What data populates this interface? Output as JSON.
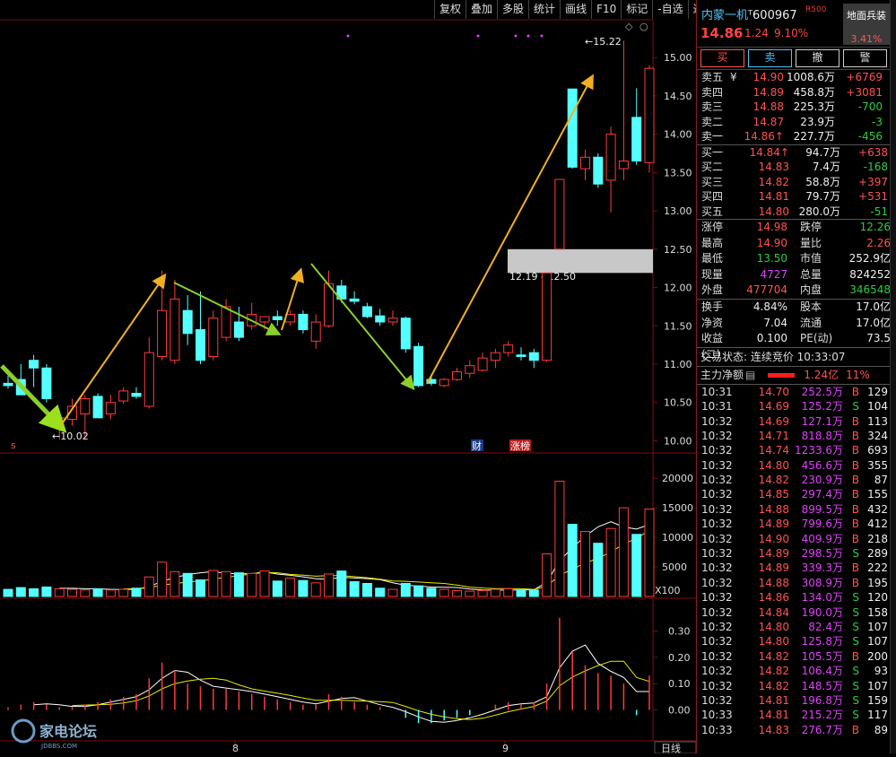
{
  "toolbar": {
    "items": [
      "复权",
      "叠加",
      "多股",
      "统计",
      "画线",
      "F10",
      "标记",
      "-自选",
      "返回"
    ]
  },
  "colors": {
    "up": "#ff3b3b",
    "down": "#54ffff",
    "ma_white": "#ffffff",
    "ma_yellow": "#e8e800",
    "arrow_orange": "#f0b020",
    "arrow_green": "#8ccf2a"
  },
  "chart": {
    "price_axis": {
      "ticks": [
        "15.00",
        "14.50",
        "14.00",
        "13.50",
        "13.00",
        "12.50",
        "12.00",
        "11.50",
        "11.00",
        "10.50",
        "10.00"
      ]
    },
    "high_label": "15.22",
    "low_label": "10.02",
    "gap_label": "12.19 - 12.50",
    "markers": {
      "s": "s",
      "cai": "财",
      "zhangbang": "涨榜"
    },
    "volume_axis": {
      "ticks": [
        "20000",
        "15000",
        "10000",
        "5000"
      ],
      "unit": "X100"
    },
    "macd_axis": {
      "ticks": [
        "0.30",
        "0.20",
        "0.10",
        "0.00"
      ]
    },
    "date_labels": {
      "m8": "8",
      "m9": "9"
    },
    "period_label": "日线",
    "watermark": {
      "text": "家电论坛",
      "sub": "JDBBS.COM"
    }
  },
  "chart_data": {
    "type": "candlestick",
    "ylim": [
      9.9,
      15.4
    ],
    "candles": [
      {
        "o": 10.75,
        "h": 10.85,
        "l": 10.68,
        "c": 10.72
      },
      {
        "o": 10.8,
        "h": 11.0,
        "l": 10.65,
        "c": 10.6
      },
      {
        "o": 11.05,
        "h": 11.12,
        "l": 10.7,
        "c": 10.95
      },
      {
        "o": 10.95,
        "h": 11.0,
        "l": 10.5,
        "c": 10.55
      },
      {
        "o": 10.25,
        "h": 10.4,
        "l": 10.02,
        "c": 10.3
      },
      {
        "o": 10.28,
        "h": 10.55,
        "l": 10.2,
        "c": 10.45
      },
      {
        "o": 10.35,
        "h": 10.6,
        "l": 10.05,
        "c": 10.55
      },
      {
        "o": 10.58,
        "h": 10.62,
        "l": 10.3,
        "c": 10.3
      },
      {
        "o": 10.35,
        "h": 10.6,
        "l": 10.28,
        "c": 10.5
      },
      {
        "o": 10.52,
        "h": 10.7,
        "l": 10.48,
        "c": 10.65
      },
      {
        "o": 10.62,
        "h": 10.7,
        "l": 10.55,
        "c": 10.58
      },
      {
        "o": 10.45,
        "h": 11.35,
        "l": 10.42,
        "c": 11.15
      },
      {
        "o": 11.1,
        "h": 12.22,
        "l": 11.05,
        "c": 11.7
      },
      {
        "o": 11.05,
        "h": 12.1,
        "l": 11.0,
        "c": 11.85
      },
      {
        "o": 11.7,
        "h": 11.9,
        "l": 11.25,
        "c": 11.4
      },
      {
        "o": 11.45,
        "h": 11.95,
        "l": 11.0,
        "c": 11.05
      },
      {
        "o": 11.1,
        "h": 11.7,
        "l": 11.05,
        "c": 11.6
      },
      {
        "o": 11.35,
        "h": 11.85,
        "l": 11.3,
        "c": 11.75
      },
      {
        "o": 11.55,
        "h": 11.75,
        "l": 11.3,
        "c": 11.35
      },
      {
        "o": 11.5,
        "h": 11.8,
        "l": 11.45,
        "c": 11.65
      },
      {
        "o": 11.55,
        "h": 11.6,
        "l": 11.45,
        "c": 11.62
      },
      {
        "o": 11.62,
        "h": 11.7,
        "l": 11.5,
        "c": 11.58
      },
      {
        "o": 11.55,
        "h": 11.7,
        "l": 11.5,
        "c": 11.65
      },
      {
        "o": 11.65,
        "h": 11.7,
        "l": 11.4,
        "c": 11.45
      },
      {
        "o": 11.3,
        "h": 11.65,
        "l": 11.2,
        "c": 11.55
      },
      {
        "o": 11.5,
        "h": 12.22,
        "l": 11.48,
        "c": 12.05
      },
      {
        "o": 12.02,
        "h": 12.1,
        "l": 11.8,
        "c": 11.85
      },
      {
        "o": 11.85,
        "h": 11.95,
        "l": 11.78,
        "c": 11.82
      },
      {
        "o": 11.75,
        "h": 11.8,
        "l": 11.6,
        "c": 11.62
      },
      {
        "o": 11.63,
        "h": 11.72,
        "l": 11.5,
        "c": 11.55
      },
      {
        "o": 11.55,
        "h": 11.7,
        "l": 11.5,
        "c": 11.6
      },
      {
        "o": 11.6,
        "h": 11.62,
        "l": 11.15,
        "c": 11.2
      },
      {
        "o": 11.23,
        "h": 11.28,
        "l": 10.7,
        "c": 10.72
      },
      {
        "o": 10.8,
        "h": 10.85,
        "l": 10.72,
        "c": 10.75
      },
      {
        "o": 10.72,
        "h": 10.82,
        "l": 10.7,
        "c": 10.8
      },
      {
        "o": 10.8,
        "h": 10.95,
        "l": 10.78,
        "c": 10.9
      },
      {
        "o": 10.88,
        "h": 11.05,
        "l": 10.82,
        "c": 10.98
      },
      {
        "o": 10.92,
        "h": 11.15,
        "l": 10.9,
        "c": 11.08
      },
      {
        "o": 11.05,
        "h": 11.2,
        "l": 10.95,
        "c": 11.15
      },
      {
        "o": 11.15,
        "h": 11.3,
        "l": 11.1,
        "c": 11.25
      },
      {
        "o": 11.12,
        "h": 11.22,
        "l": 11.05,
        "c": 11.1
      },
      {
        "o": 11.15,
        "h": 11.2,
        "l": 10.95,
        "c": 11.05
      },
      {
        "o": 11.05,
        "h": 12.19,
        "l": 11.03,
        "c": 12.19
      },
      {
        "o": 12.5,
        "h": 13.41,
        "l": 12.5,
        "c": 13.41
      },
      {
        "o": 14.59,
        "h": 14.59,
        "l": 13.55,
        "c": 13.57
      },
      {
        "o": 13.55,
        "h": 13.8,
        "l": 13.4,
        "c": 13.7
      },
      {
        "o": 13.7,
        "h": 13.75,
        "l": 13.3,
        "c": 13.35
      },
      {
        "o": 13.4,
        "h": 14.1,
        "l": 12.98,
        "c": 14.0
      },
      {
        "o": 13.55,
        "h": 15.22,
        "l": 13.4,
        "c": 13.65
      },
      {
        "o": 14.22,
        "h": 14.6,
        "l": 13.6,
        "c": 13.65
      },
      {
        "o": 13.63,
        "h": 14.9,
        "l": 13.5,
        "c": 14.86
      }
    ],
    "volume_ylim": [
      0,
      22000
    ],
    "volumes": [
      1200,
      1500,
      1300,
      1600,
      1300,
      1200,
      1100,
      1300,
      1100,
      1200,
      1400,
      3300,
      5800,
      4200,
      3900,
      2800,
      4400,
      4200,
      4000,
      3900,
      4300,
      2600,
      3100,
      2700,
      2300,
      3800,
      4300,
      2500,
      2200,
      1400,
      1200,
      2200,
      1800,
      1400,
      1200,
      1000,
      900,
      1000,
      1200,
      1300,
      1100,
      1100,
      7200,
      19500,
      12200,
      11000,
      9000,
      11500,
      15000,
      10500,
      14800
    ],
    "macd_ylim": [
      -0.08,
      0.38
    ],
    "macd": [
      0.01,
      0.02,
      0.03,
      0.02,
      0.01,
      0.01,
      0.02,
      0.03,
      0.04,
      0.05,
      0.06,
      0.12,
      0.18,
      0.15,
      0.1,
      0.09,
      0.08,
      0.08,
      0.07,
      0.06,
      0.05,
      0.04,
      0.03,
      0.02,
      0.02,
      0.06,
      0.05,
      0.03,
      0.02,
      0.01,
      0.0,
      -0.03,
      -0.05,
      -0.05,
      -0.04,
      -0.03,
      -0.02,
      0.0,
      0.02,
      0.03,
      0.02,
      0.03,
      0.1,
      0.35,
      0.22,
      0.17,
      0.14,
      0.13,
      0.1,
      -0.02,
      0.13
    ]
  },
  "panel": {
    "name": "内蒙一机",
    "code": "600967",
    "tag": "R500",
    "last": "14.86",
    "change": "1.24",
    "percent": "9.10%",
    "block_name": "地面兵装",
    "block_pct": "3.41%",
    "buttons": [
      "买",
      "卖",
      "撤",
      "警"
    ],
    "asks": [
      {
        "label": "卖五",
        "extra": "¥",
        "price": "14.90",
        "vol": "1008.6万",
        "diff": "+6769",
        "diff_color": "#ff5252"
      },
      {
        "label": "卖四",
        "extra": "",
        "price": "14.89",
        "vol": "458.8万",
        "diff": "+3081",
        "diff_color": "#ff5252"
      },
      {
        "label": "卖三",
        "extra": "",
        "price": "14.88",
        "vol": "225.3万",
        "diff": "-700",
        "diff_color": "#2ecc40"
      },
      {
        "label": "卖二",
        "extra": "",
        "price": "14.87",
        "vol": "23.9万",
        "diff": "-3",
        "diff_color": "#2ecc40"
      },
      {
        "label": "卖一",
        "extra": "",
        "price": "14.86↑",
        "vol": "227.7万",
        "diff": "-456",
        "diff_color": "#2ecc40"
      }
    ],
    "bids": [
      {
        "label": "买一",
        "price": "14.84↑",
        "vol": "94.7万",
        "diff": "+638",
        "diff_color": "#ff5252"
      },
      {
        "label": "买二",
        "price": "14.83",
        "vol": "7.4万",
        "diff": "-168",
        "diff_color": "#2ecc40"
      },
      {
        "label": "买三",
        "price": "14.82",
        "vol": "58.8万",
        "diff": "+397",
        "diff_color": "#ff5252"
      },
      {
        "label": "买四",
        "price": "14.81",
        "vol": "79.7万",
        "diff": "+531",
        "diff_color": "#ff5252"
      },
      {
        "label": "买五",
        "price": "14.80",
        "vol": "280.0万",
        "diff": "-51",
        "diff_color": "#2ecc40"
      }
    ],
    "quote": [
      {
        "l1": "涨停",
        "v1": "14.98",
        "c1": "#ff5252",
        "l2": "跌停",
        "v2": "12.26",
        "c2": "#2ecc40"
      },
      {
        "l1": "最高",
        "v1": "14.90",
        "c1": "#ff5252",
        "l2": "量比",
        "v2": "2.26",
        "c2": "#ff5252"
      },
      {
        "l1": "最低",
        "v1": "13.50",
        "c1": "#2ecc40",
        "l2": "市值",
        "v2": "252.9亿",
        "c2": "#eeeeee"
      },
      {
        "l1": "现量",
        "v1": "4727",
        "c1": "#e040fb",
        "l2": "总量",
        "v2": "824252",
        "c2": "#eeeeee"
      },
      {
        "l1": "外盘",
        "v1": "477704",
        "c1": "#ff5252",
        "l2": "内盘",
        "v2": "346548",
        "c2": "#2ecc40"
      },
      {
        "l1": "换手",
        "v1": "4.84%",
        "c1": "#eeeeee",
        "l2": "股本",
        "v2": "17.0亿",
        "c2": "#eeeeee"
      },
      {
        "l1": "净资",
        "v1": "7.04",
        "c1": "#eeeeee",
        "l2": "流通",
        "v2": "17.0亿",
        "c2": "#eeeeee"
      },
      {
        "l1": "收益(二)",
        "v1": "0.100",
        "c1": "#eeeeee",
        "l2": "PE(动)",
        "v2": "73.5",
        "c2": "#eeeeee"
      }
    ],
    "status": "交易状态: 连续竞价 10:33:07",
    "netflow": {
      "label": "主力净额",
      "value": "1.24亿",
      "pct": "11%"
    },
    "ticks": [
      {
        "t": "10:31",
        "p": "14.70",
        "a": "252.5万",
        "s": "B",
        "n": "129"
      },
      {
        "t": "10:31",
        "p": "14.69",
        "a": "125.2万",
        "s": "S",
        "n": "104"
      },
      {
        "t": "10:32",
        "p": "14.69",
        "a": "127.1万",
        "s": "B",
        "n": "113"
      },
      {
        "t": "10:32",
        "p": "14.71",
        "a": "818.8万",
        "s": "B",
        "n": "324"
      },
      {
        "t": "10:32",
        "p": "14.74",
        "a": "1233.6万",
        "s": "B",
        "n": "693"
      },
      {
        "t": "10:32",
        "p": "14.80",
        "a": "456.6万",
        "s": "B",
        "n": "355"
      },
      {
        "t": "10:32",
        "p": "14.82",
        "a": "230.9万",
        "s": "B",
        "n": "87"
      },
      {
        "t": "10:32",
        "p": "14.85",
        "a": "297.4万",
        "s": "B",
        "n": "155"
      },
      {
        "t": "10:32",
        "p": "14.88",
        "a": "899.5万",
        "s": "B",
        "n": "432"
      },
      {
        "t": "10:32",
        "p": "14.89",
        "a": "799.6万",
        "s": "B",
        "n": "412"
      },
      {
        "t": "10:32",
        "p": "14.90",
        "a": "409.9万",
        "s": "B",
        "n": "218"
      },
      {
        "t": "10:32",
        "p": "14.89",
        "a": "298.5万",
        "s": "S",
        "n": "289"
      },
      {
        "t": "10:32",
        "p": "14.89",
        "a": "339.3万",
        "s": "B",
        "n": "222"
      },
      {
        "t": "10:32",
        "p": "14.88",
        "a": "308.9万",
        "s": "B",
        "n": "195"
      },
      {
        "t": "10:32",
        "p": "14.86",
        "a": "134.0万",
        "s": "S",
        "n": "120"
      },
      {
        "t": "10:32",
        "p": "14.84",
        "a": "190.0万",
        "s": "S",
        "n": "158"
      },
      {
        "t": "10:32",
        "p": "14.80",
        "a": "82.4万",
        "s": "S",
        "n": "107"
      },
      {
        "t": "10:32",
        "p": "14.80",
        "a": "125.8万",
        "s": "S",
        "n": "107"
      },
      {
        "t": "10:32",
        "p": "14.82",
        "a": "105.5万",
        "s": "B",
        "n": "200"
      },
      {
        "t": "10:32",
        "p": "14.82",
        "a": "106.4万",
        "s": "S",
        "n": "93"
      },
      {
        "t": "10:32",
        "p": "14.82",
        "a": "148.5万",
        "s": "S",
        "n": "107"
      },
      {
        "t": "10:32",
        "p": "14.81",
        "a": "196.8万",
        "s": "S",
        "n": "159"
      },
      {
        "t": "10:33",
        "p": "14.81",
        "a": "215.2万",
        "s": "S",
        "n": "117"
      },
      {
        "t": "10:33",
        "p": "14.83",
        "a": "276.7万",
        "s": "B",
        "n": "89"
      }
    ]
  }
}
